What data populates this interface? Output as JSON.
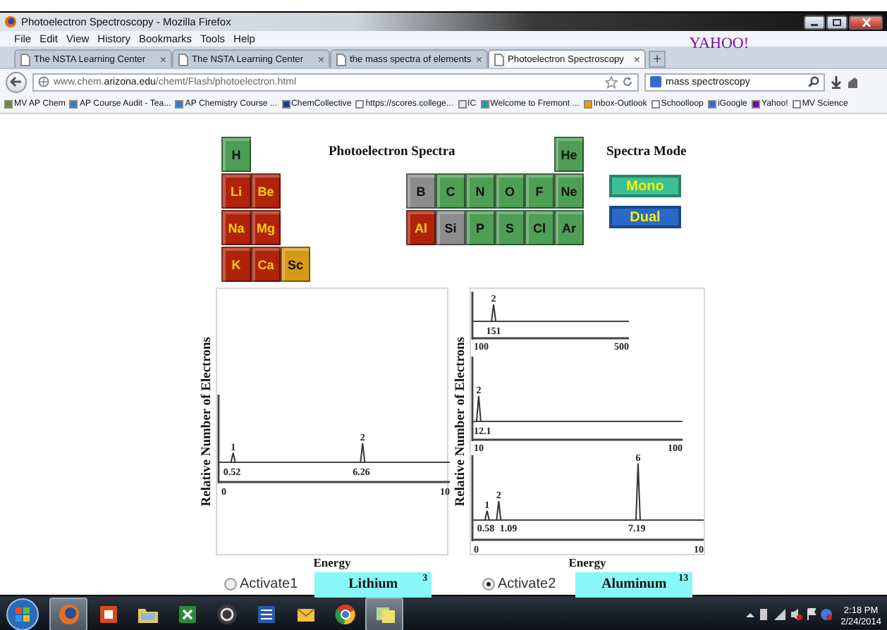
{
  "browser": {
    "title": "Photoelectron Spectroscopy - Mozilla Firefox",
    "menu": [
      "File",
      "Edit",
      "View",
      "History",
      "Bookmarks",
      "Tools",
      "Help"
    ],
    "logo": "YAHOO!",
    "tabs": [
      {
        "label": "The NSTA Learning Center",
        "close": "×",
        "selected": false
      },
      {
        "label": "The NSTA Learning Center",
        "close": "×",
        "selected": false
      },
      {
        "label": "the mass spectra of elements",
        "close": "×",
        "selected": false
      },
      {
        "label": "Photoelectron Spectroscopy",
        "close": "×",
        "selected": true
      }
    ],
    "new_tab": "+",
    "address": "www.chem.**arizona.edu**/chemt/Flash/photoelectron.html",
    "search": "mass spectroscopy",
    "bookmarks": [
      {
        "label": "MV AP Chem",
        "color": "#6a8a3a"
      },
      {
        "label": "AP Course Audit - Tea...",
        "color": "#2a7fd0"
      },
      {
        "label": "AP Chemistry Course ...",
        "color": "#2a7fd0"
      },
      {
        "label": "ChemCollective",
        "color": "#1a3a8a"
      },
      {
        "label": "https://scores.college...",
        "color": "#ffffff"
      },
      {
        "label": "IC",
        "color": "#e8e8e8"
      },
      {
        "label": "Welcome to Fremont ...",
        "color": "#2a9a9a"
      },
      {
        "label": "Inbox-Outlook",
        "color": "#f0a000"
      },
      {
        "label": "Schoolloop",
        "color": "#ffffff"
      },
      {
        "label": "iGoogle",
        "color": "#3a6ad0"
      },
      {
        "label": "Yahoo!",
        "color": "#6a0aa0"
      },
      {
        "label": "MV Science",
        "color": "#ffffff"
      }
    ]
  },
  "page": {
    "title": "Photoelectron Spectra",
    "table_left": [
      [
        {
          "symbol": "H",
          "color": "#4e9e56"
        }
      ],
      [
        {
          "symbol": "Li",
          "color": "#b0220a"
        },
        {
          "symbol": "Be",
          "color": "#b0220a"
        }
      ],
      [
        {
          "symbol": "Na",
          "color": "#b0220a"
        },
        {
          "symbol": "Mg",
          "color": "#b0220a"
        }
      ],
      [
        {
          "symbol": "K",
          "color": "#b0220a"
        },
        {
          "symbol": "Ca",
          "color": "#b0220a"
        },
        {
          "symbol": "Sc",
          "color": "#d49a14"
        }
      ]
    ],
    "table_right": [
      [
        {
          "symbol": "He",
          "color": "#4e9e56"
        }
      ],
      [
        {
          "symbol": "B",
          "color": "#8c8c8c"
        },
        {
          "symbol": "C",
          "color": "#4e9e56"
        },
        {
          "symbol": "N",
          "color": "#4e9e56"
        },
        {
          "symbol": "O",
          "color": "#4e9e56"
        },
        {
          "symbol": "F",
          "color": "#4e9e56"
        },
        {
          "symbol": "Ne",
          "color": "#4e9e56"
        }
      ],
      [
        {
          "symbol": "Al",
          "color": "#b0220a"
        },
        {
          "symbol": "Si",
          "color": "#8c8c8c"
        },
        {
          "symbol": "P",
          "color": "#4e9e56"
        },
        {
          "symbol": "S",
          "color": "#4e9e56"
        },
        {
          "symbol": "Cl",
          "color": "#4e9e56"
        },
        {
          "symbol": "Ar",
          "color": "#4e9e56"
        }
      ]
    ],
    "mode": {
      "title": "Spectra Mode",
      "buttons": [
        {
          "label": "Mono",
          "color": "#3cbf96"
        },
        {
          "label": "Dual",
          "color": "#2a68c8"
        }
      ]
    },
    "spectra": [
      {
        "ylabel": "Relative Number of Electrons",
        "xlabel": "Energy",
        "activate": {
          "label": "Activate1",
          "selected": false
        },
        "element": {
          "name": "Lithium",
          "number": "3"
        },
        "panels": [
          {
            "ticks": [
              "0",
              "10"
            ],
            "peaks": [
              {
                "count": "1",
                "energy": "0.52"
              },
              {
                "count": "2",
                "energy": "6.26"
              }
            ]
          }
        ]
      },
      {
        "ylabel": "Relative Number of Electrons",
        "xlabel": "Energy",
        "activate": {
          "label": "Activate2",
          "selected": true
        },
        "element": {
          "name": "Aluminum",
          "number": "13"
        },
        "panels": [
          {
            "ticks": [
              "100",
              "500"
            ],
            "peaks": [
              {
                "count": "2",
                "energy": "151"
              }
            ]
          },
          {
            "ticks": [
              "10",
              "100"
            ],
            "peaks": [
              {
                "count": "2",
                "energy": "12.1"
              }
            ]
          },
          {
            "ticks": [
              "0",
              "10"
            ],
            "peaks": [
              {
                "count": "1",
                "energy": "0.58"
              },
              {
                "count": "2",
                "energy": "1.09"
              },
              {
                "count": "6",
                "energy": "7.19"
              }
            ]
          }
        ]
      }
    ]
  },
  "taskbar": {
    "apps": [
      {
        "kind": "globe",
        "active": true
      },
      {
        "kind": "slides",
        "active": false
      },
      {
        "kind": "folder",
        "active": false
      },
      {
        "kind": "sheet",
        "active": false
      },
      {
        "kind": "disc",
        "active": false
      },
      {
        "kind": "document",
        "active": false
      },
      {
        "kind": "mail",
        "active": false
      },
      {
        "kind": "wheel",
        "active": false
      },
      {
        "kind": "notes",
        "active": true
      }
    ],
    "time": "2:18 PM",
    "date": "2/24/2014"
  }
}
